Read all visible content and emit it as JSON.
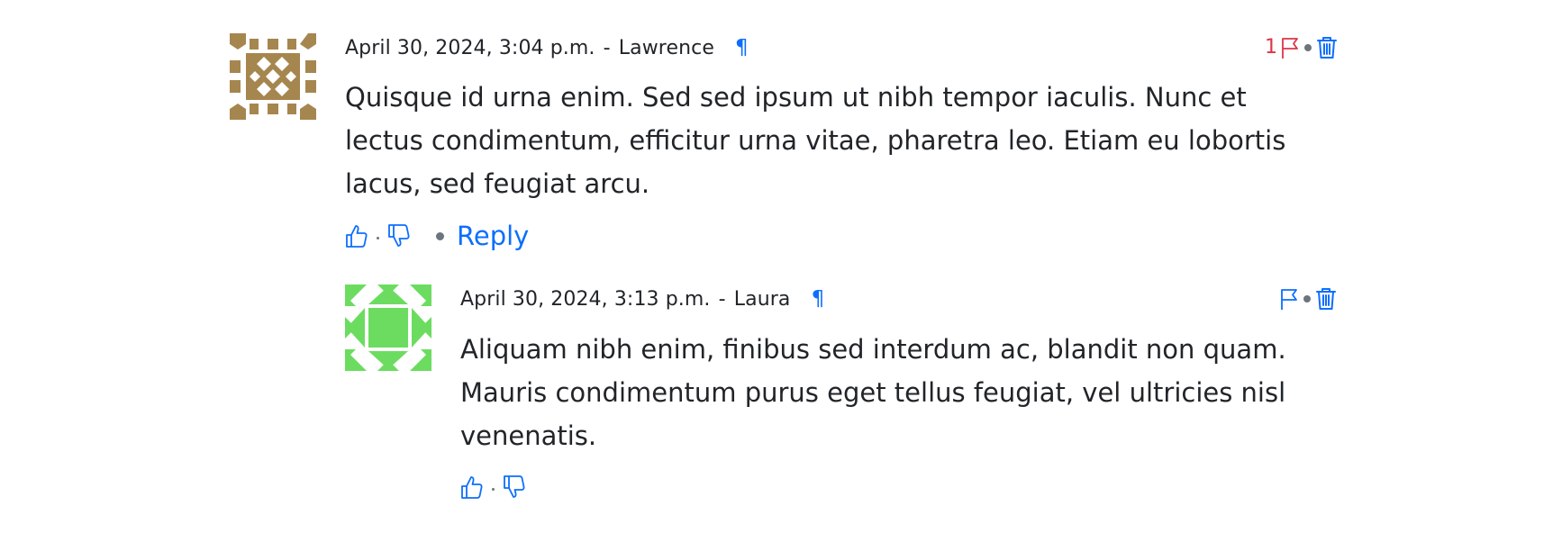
{
  "comments": [
    {
      "date": "April 30, 2024, 3:04 p.m.",
      "separator": "-",
      "author": "Lawrence",
      "permalink_symbol": "¶",
      "flag_count": "1",
      "text": "Quisque id urna enim. Sed sed ipsum ut nibh tempor iaculis. Nunc et lectus condimentum, efficitur urna vitae, pharetra leo. Etiam eu lobortis lacus, sed feugiat arcu.",
      "reply_label": "Reply",
      "avatar_color": "#a6864f"
    },
    {
      "date": "April 30, 2024, 3:13 p.m.",
      "separator": "-",
      "author": "Laura",
      "permalink_symbol": "¶",
      "text": "Aliquam nibh enim, finibus sed interdum ac, blandit non quam. Mauris condimentum purus eget tellus feugiat, vel ultricies nisl venenatis.",
      "avatar_color": "#6cdc60"
    }
  ],
  "icons": {
    "flag": "flag-icon",
    "delete": "trash-icon",
    "like": "thumbs-up-icon",
    "dislike": "thumbs-down-icon"
  },
  "colors": {
    "link": "#0d6efd",
    "flagged": "#dc3545",
    "text": "#212529",
    "muted": "#6c757d"
  }
}
